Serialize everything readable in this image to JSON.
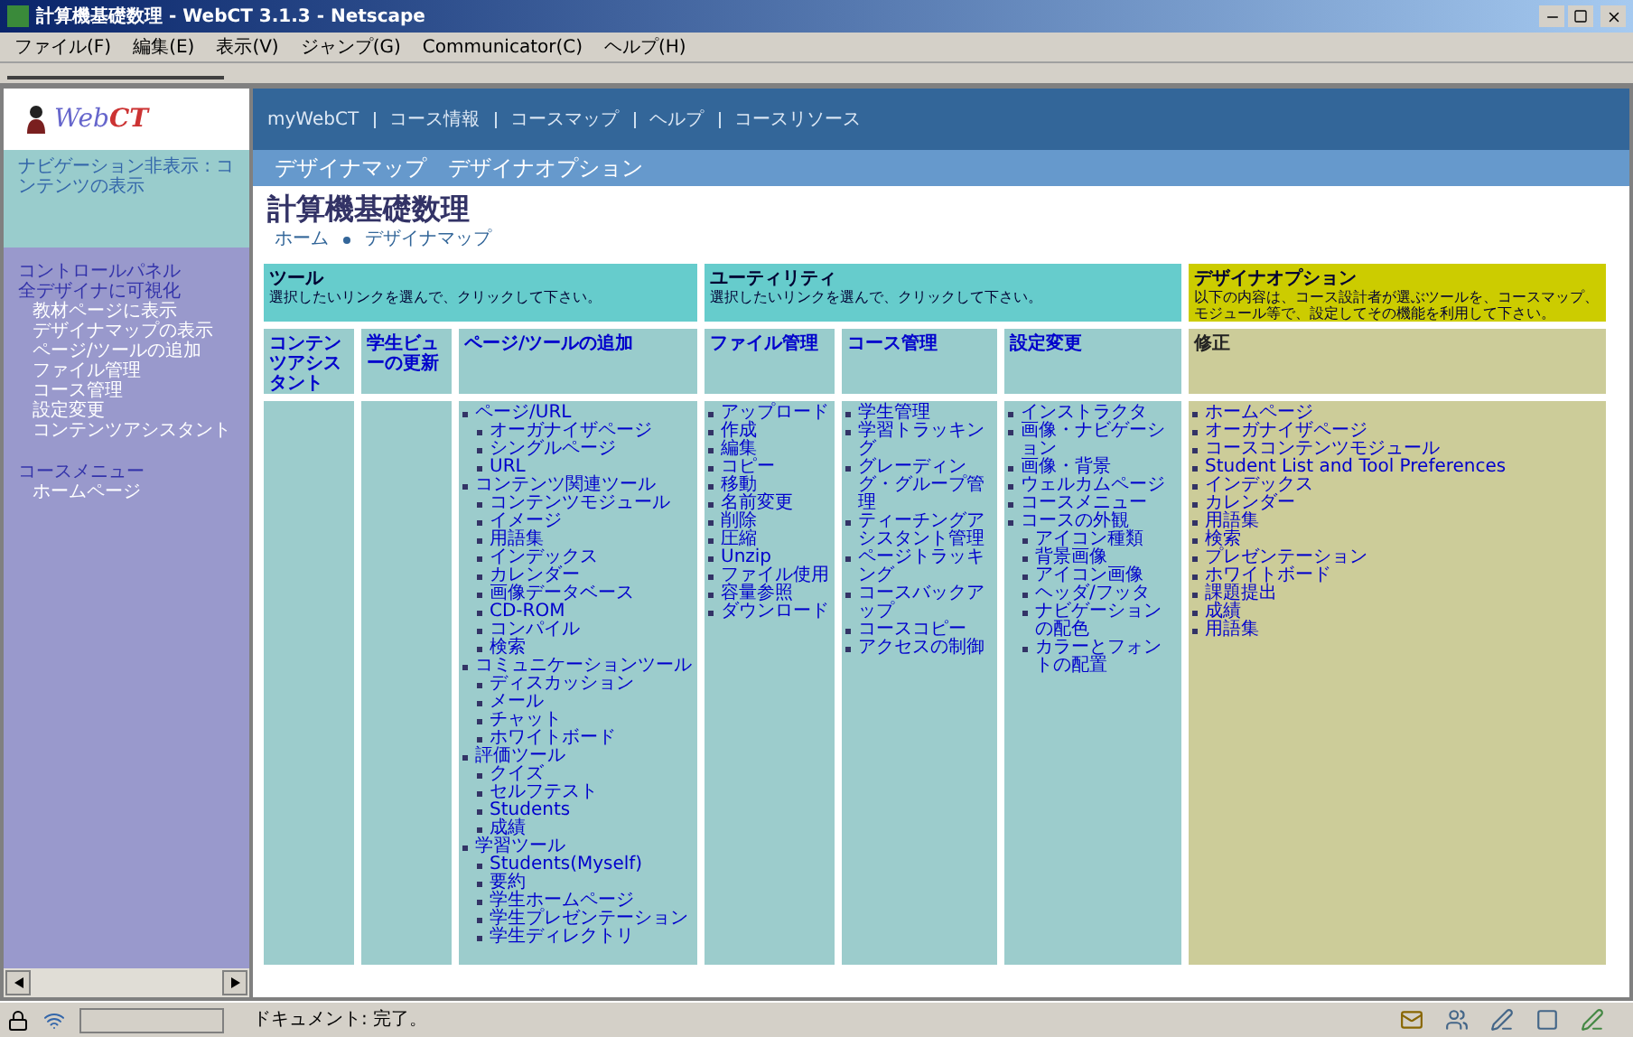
{
  "window": {
    "title": "計算機基礎数理 - WebCT 3.1.3 - Netscape"
  },
  "menu": [
    "ファイル(F)",
    "編集(E)",
    "表示(V)",
    "ジャンプ(G)",
    "Communicator(C)",
    "ヘルプ(H)"
  ],
  "logo": {
    "prefix": "Web",
    "suffix": "CT"
  },
  "sidebar": {
    "toggle": "ナビゲーション非表示 : コンテンツの表示",
    "sections": [
      {
        "heading": "コントロールパネル",
        "subheading": "全デザイナに可視化",
        "items": [
          "教材ページに表示",
          "デザイナマップの表示",
          "ページ/ツールの追加",
          "ファイル管理",
          "コース管理",
          "設定変更",
          "コンテンツアシスタント"
        ]
      },
      {
        "heading": "コースメニュー",
        "items": [
          "ホームページ"
        ]
      }
    ]
  },
  "top_nav": [
    "myWebCT",
    "コース情報",
    "コースマップ",
    "ヘルプ",
    "コースリソース"
  ],
  "designer_links": [
    "デザイナマップ",
    "デザイナオプション"
  ],
  "page": {
    "title": "計算機基礎数理",
    "breadcrumb": [
      "ホーム",
      "デザイナマップ"
    ]
  },
  "table": {
    "groups": [
      {
        "kind": "tools",
        "title": "ツール",
        "description": "選択したいリンクを選んで、クリックして下さい。",
        "columns": [
          {
            "heading": "コンテンツアシスタント"
          },
          {
            "heading": "学生ビューの更新"
          },
          {
            "heading": "ページ/ツールの追加",
            "items": [
              {
                "label": "ページ/URL",
                "children": [
                  {
                    "label": "オーガナイザページ"
                  },
                  {
                    "label": "シングルページ"
                  },
                  {
                    "label": "URL"
                  }
                ]
              },
              {
                "label": "コンテンツ関連ツール",
                "children": [
                  {
                    "label": "コンテンツモジュール"
                  },
                  {
                    "label": "イメージ"
                  },
                  {
                    "label": "用語集"
                  },
                  {
                    "label": "インデックス"
                  },
                  {
                    "label": "カレンダー"
                  },
                  {
                    "label": "画像データベース"
                  },
                  {
                    "label": "CD-ROM"
                  },
                  {
                    "label": "コンパイル"
                  },
                  {
                    "label": "検索"
                  }
                ]
              },
              {
                "label": "コミュニケーションツール",
                "children": [
                  {
                    "label": "ディスカッション"
                  },
                  {
                    "label": "メール"
                  },
                  {
                    "label": "チャット"
                  },
                  {
                    "label": "ホワイトボード"
                  }
                ]
              },
              {
                "label": "評価ツール",
                "children": [
                  {
                    "label": "クイズ"
                  },
                  {
                    "label": "セルフテスト"
                  },
                  {
                    "label": "Students"
                  },
                  {
                    "label": "成績"
                  }
                ]
              },
              {
                "label": "学習ツール",
                "children": [
                  {
                    "label": "Students(Myself)"
                  },
                  {
                    "label": "要約"
                  },
                  {
                    "label": "学生ホームページ"
                  },
                  {
                    "label": "学生プレゼンテーション"
                  },
                  {
                    "label": "学生ディレクトリ"
                  }
                ]
              }
            ]
          }
        ]
      },
      {
        "kind": "utilities",
        "title": "ユーティリティ",
        "description": "選択したいリンクを選んで、クリックして下さい。",
        "columns": [
          {
            "heading": "ファイル管理",
            "items": [
              {
                "label": "アップロード"
              },
              {
                "label": "作成"
              },
              {
                "label": "編集"
              },
              {
                "label": "コピー"
              },
              {
                "label": "移動"
              },
              {
                "label": "名前変更"
              },
              {
                "label": "削除"
              },
              {
                "label": "圧縮"
              },
              {
                "label": "Unzip"
              },
              {
                "label": "ファイル使用"
              },
              {
                "label": "容量参照"
              },
              {
                "label": "ダウンロード"
              }
            ]
          },
          {
            "heading": "コース管理",
            "items": [
              {
                "label": "学生管理"
              },
              {
                "label": "学習トラッキング"
              },
              {
                "label": "グレーディング・グループ管理"
              },
              {
                "label": "ティーチングアシスタント管理"
              },
              {
                "label": "ページトラッキング"
              },
              {
                "label": "コースバックアップ"
              },
              {
                "label": "コースコピー"
              },
              {
                "label": "アクセスの制御"
              }
            ]
          },
          {
            "heading": "設定変更",
            "items": [
              {
                "label": "インストラクタ"
              },
              {
                "label": "画像・ナビゲーション"
              },
              {
                "label": "画像・背景"
              },
              {
                "label": "ウェルカムページ"
              },
              {
                "label": "コースメニュー"
              },
              {
                "label": "コースの外観",
                "children": [
                  {
                    "label": "アイコン種類"
                  },
                  {
                    "label": "背景画像"
                  },
                  {
                    "label": "アイコン画像"
                  },
                  {
                    "label": "ヘッダ/フッタ"
                  },
                  {
                    "label": "ナビゲーションの配色"
                  },
                  {
                    "label": "カラーとフォントの配置"
                  }
                ]
              }
            ]
          }
        ]
      },
      {
        "kind": "options",
        "title": "デザイナオプション",
        "description": "以下の内容は、コース設計者が選ぶツールを、コースマップ、モジュール等で、設定してその機能を利用して下さい。",
        "columns": [
          {
            "heading": "修正",
            "items": [
              {
                "label": "ホームページ"
              },
              {
                "label": "オーガナイザページ"
              },
              {
                "label": "コースコンテンツモジュール"
              },
              {
                "label": "Student List and Tool Preferences"
              },
              {
                "label": "インデックス"
              },
              {
                "label": "カレンダー"
              },
              {
                "label": "用語集"
              },
              {
                "label": "検索"
              },
              {
                "label": "プレゼンテーション"
              },
              {
                "label": "ホワイトボード"
              },
              {
                "label": "課題提出"
              },
              {
                "label": "成績"
              },
              {
                "label": "用語集"
              }
            ]
          }
        ]
      }
    ]
  },
  "status_bar": {
    "text": "ドキュメント: 完了。"
  }
}
